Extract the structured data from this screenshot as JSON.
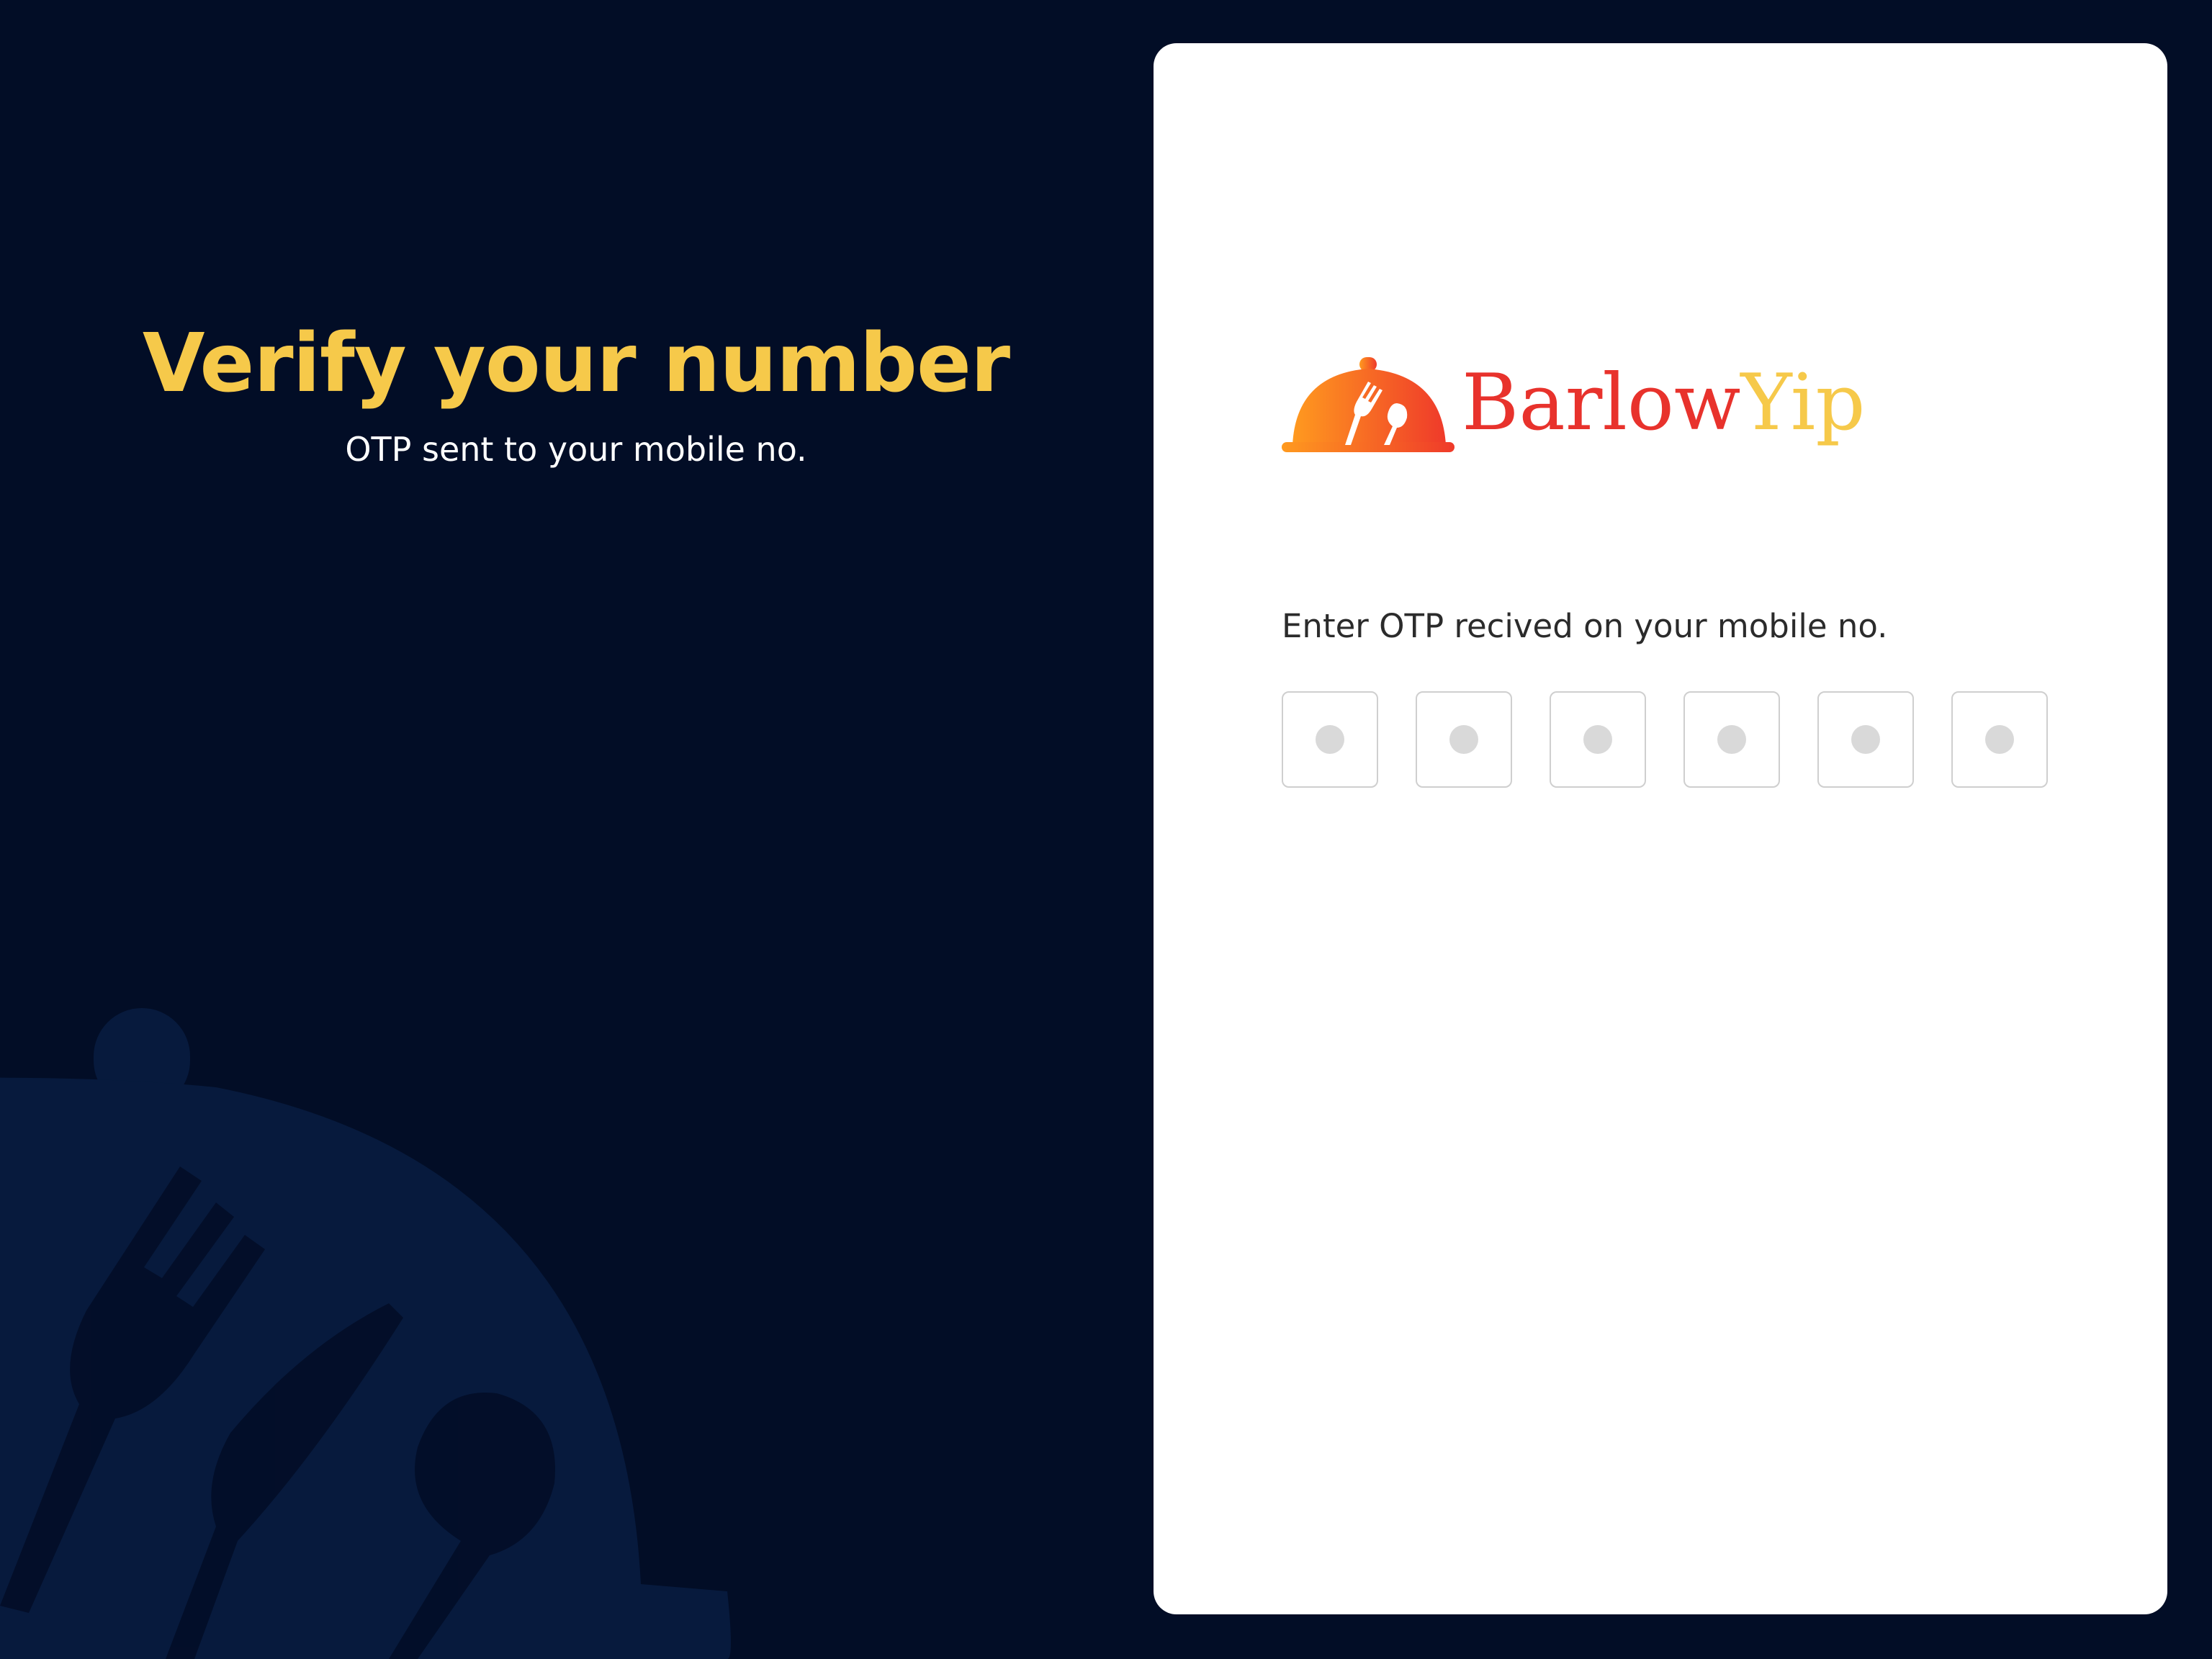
{
  "hero": {
    "title": "Verify your number",
    "subtitle": "OTP sent to your mobile no."
  },
  "brand": {
    "name_part1": "Barlow",
    "name_part2": "Yip",
    "logo_icon": "cloche-cutlery-icon",
    "colors": {
      "red": "#e8322c",
      "yellow": "#f6c94a",
      "orange": "#ff8a1f"
    }
  },
  "otp": {
    "label": "Enter OTP recived on your mobile no.",
    "digits": [
      "",
      "",
      "",
      "",
      "",
      ""
    ]
  },
  "theme": {
    "background": "#020d26",
    "background_pattern": "#071a3d",
    "accent": "#f6c94a"
  }
}
